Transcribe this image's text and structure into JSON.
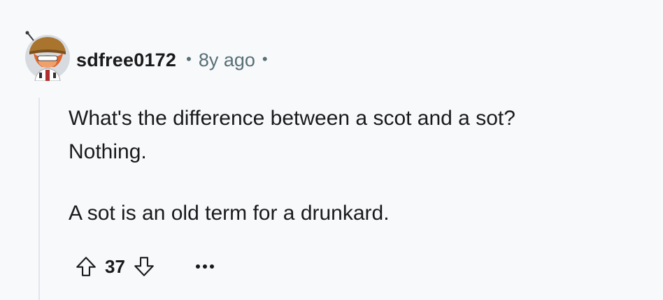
{
  "comment": {
    "author": "sdfree0172",
    "separator": "•",
    "timestamp": "8y ago",
    "body": {
      "line1": "What's the difference between a scot and a sot?",
      "line2": "Nothing.",
      "line3": "A sot is an old term for a drunkard."
    },
    "score": "37",
    "more_label": "•••"
  },
  "colors": {
    "background": "#f7f9fb",
    "text": "#1a1a1b",
    "meta": "#576f76",
    "thread_line": "#e1e5e9"
  },
  "icons": {
    "upvote": "upvote-arrow-icon",
    "downvote": "downvote-arrow-icon",
    "more": "more-options-icon",
    "avatar": "user-avatar"
  }
}
